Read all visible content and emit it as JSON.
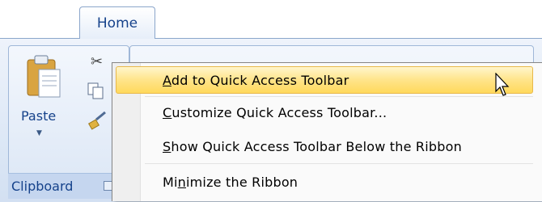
{
  "ribbon": {
    "tab_label": "Home",
    "group_label": "Clipboard",
    "paste_label": "Paste"
  },
  "menu": {
    "items": [
      {
        "pre": "",
        "key": "A",
        "post": "dd to Quick Access Toolbar",
        "highlighted": true
      },
      {
        "pre": "",
        "key": "C",
        "post": "ustomize Quick Access Toolbar...",
        "highlighted": false
      },
      {
        "pre": "",
        "key": "S",
        "post": "how Quick Access Toolbar Below the Ribbon",
        "highlighted": false
      },
      {
        "pre": "Mi",
        "key": "n",
        "post": "imize the Ribbon",
        "highlighted": false
      }
    ]
  },
  "colors": {
    "highlight_top": "#fff6cc",
    "highlight_bottom": "#ffd95c",
    "ribbon_text": "#15428b"
  },
  "icons": [
    "paste-icon",
    "cut-icon",
    "copy-icon",
    "format-painter-icon",
    "dialog-launcher-icon",
    "mouse-pointer-icon"
  ]
}
